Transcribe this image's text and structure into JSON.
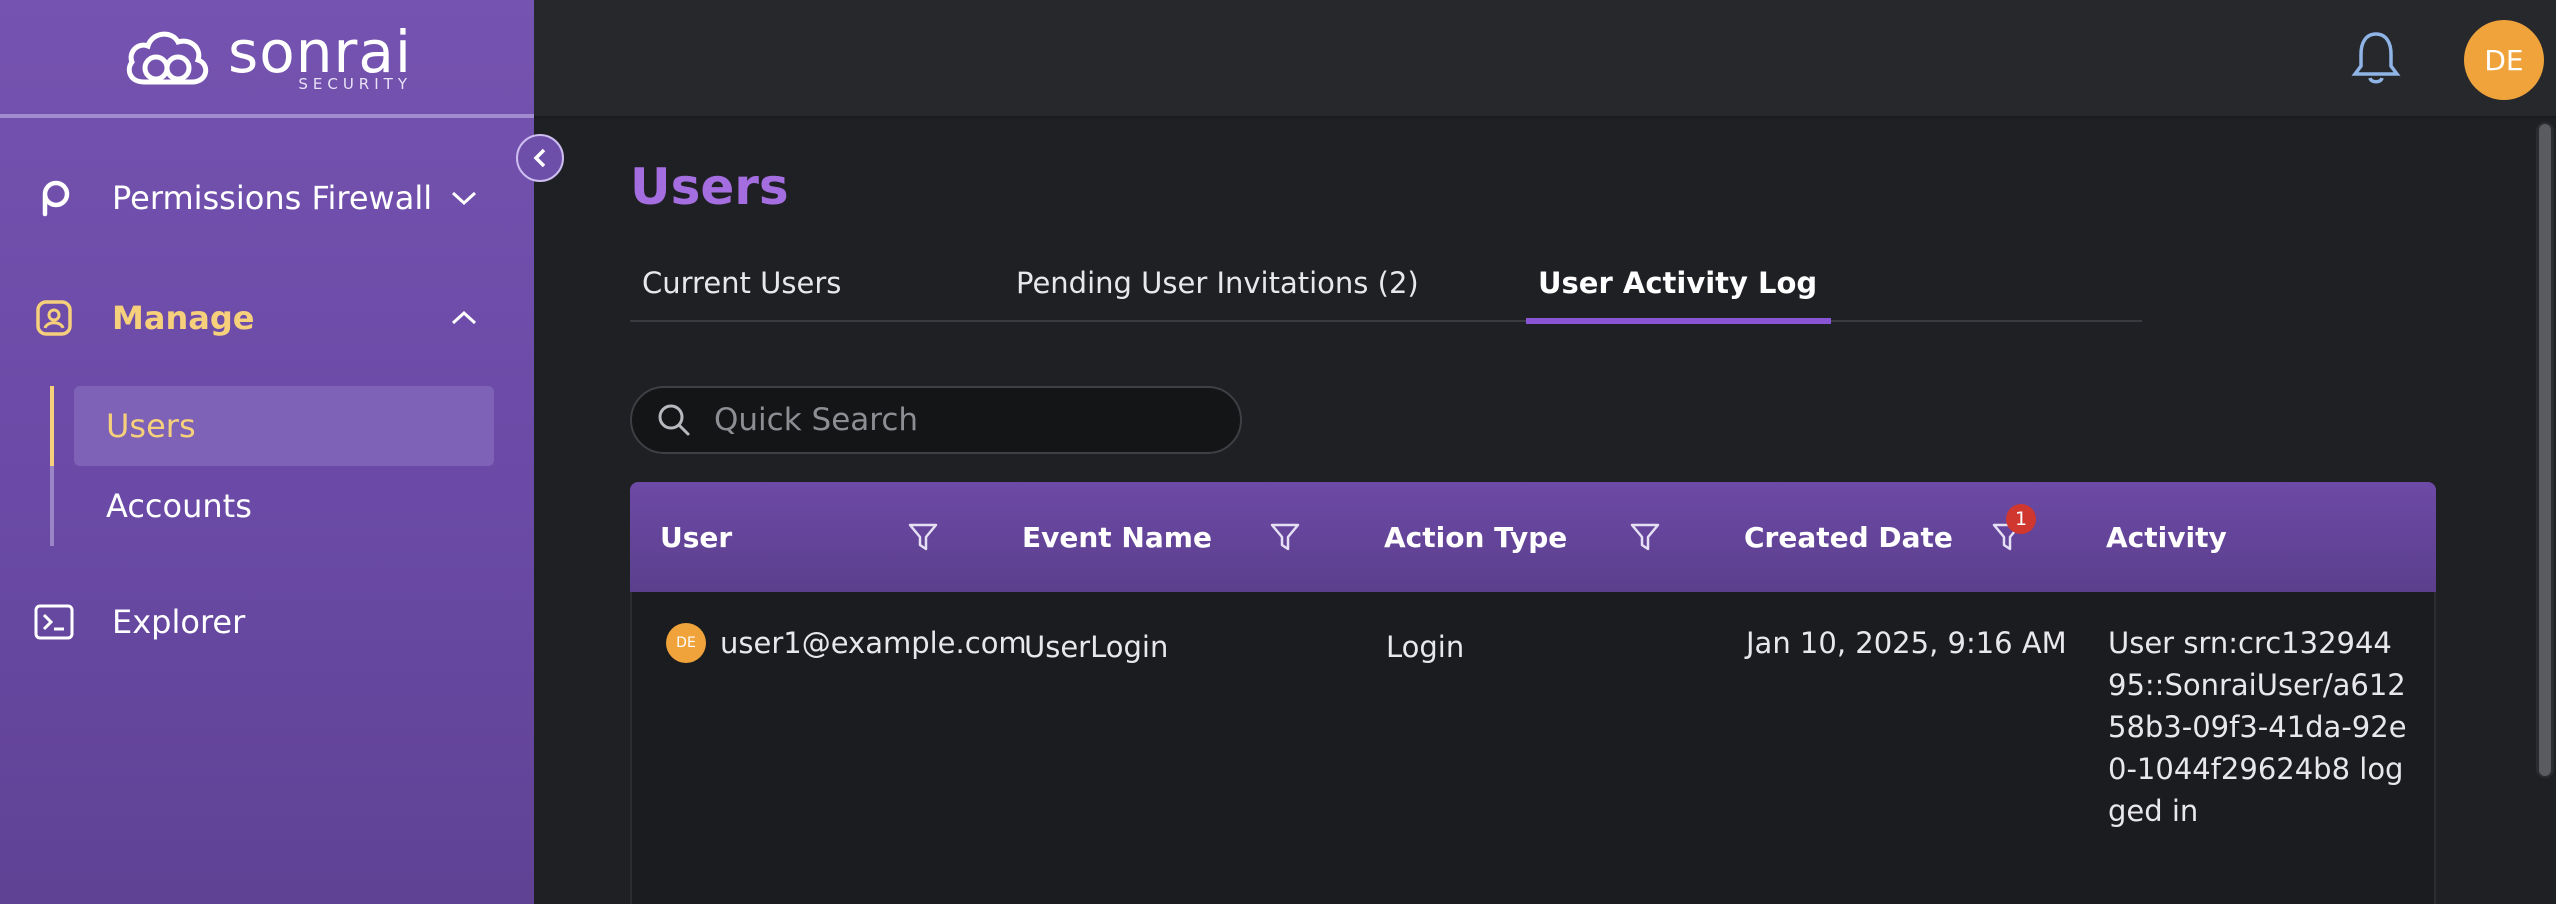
{
  "brand": {
    "name": "sonrai",
    "sub": "SECURITY"
  },
  "sidebar": {
    "items": [
      {
        "label": "Permissions Firewall",
        "icon": "p-logo-icon",
        "expanded": false
      },
      {
        "label": "Manage",
        "icon": "user-badge-icon",
        "expanded": true
      },
      {
        "label": "Explorer",
        "icon": "terminal-icon",
        "expanded": false
      }
    ],
    "manage_sub": [
      {
        "label": "Users",
        "active": true
      },
      {
        "label": "Accounts",
        "active": false
      }
    ]
  },
  "topbar": {
    "avatar_initials": "DE"
  },
  "page": {
    "title": "Users"
  },
  "tabs": [
    {
      "label": "Current Users",
      "active": false
    },
    {
      "label": "Pending User Invitations (2)",
      "active": false
    },
    {
      "label": "User Activity Log",
      "active": true
    }
  ],
  "search": {
    "placeholder": "Quick Search",
    "value": ""
  },
  "table": {
    "columns": [
      {
        "label": "User",
        "filter_badge": null
      },
      {
        "label": "Event Name",
        "filter_badge": null
      },
      {
        "label": "Action Type",
        "filter_badge": null
      },
      {
        "label": "Created Date",
        "filter_badge": "1"
      },
      {
        "label": "Activity",
        "filter_badge": null
      }
    ],
    "rows": [
      {
        "avatar_initials": "DE",
        "user": "user1@example.com",
        "event_name": "UserLogin",
        "action_type": "Login",
        "created_date": "Jan 10, 2025, 9:16 AM",
        "activity": "User srn:crc13294495::SonraiUser/a61258b3-09f3-41da-92e0-1044f29624b8 logged in"
      }
    ]
  },
  "colors": {
    "sidebar": "#6f4fab",
    "accent": "#a46ee0",
    "active_text": "#f6d07a",
    "avatar": "#f0a33b",
    "badge": "#d0382f"
  }
}
